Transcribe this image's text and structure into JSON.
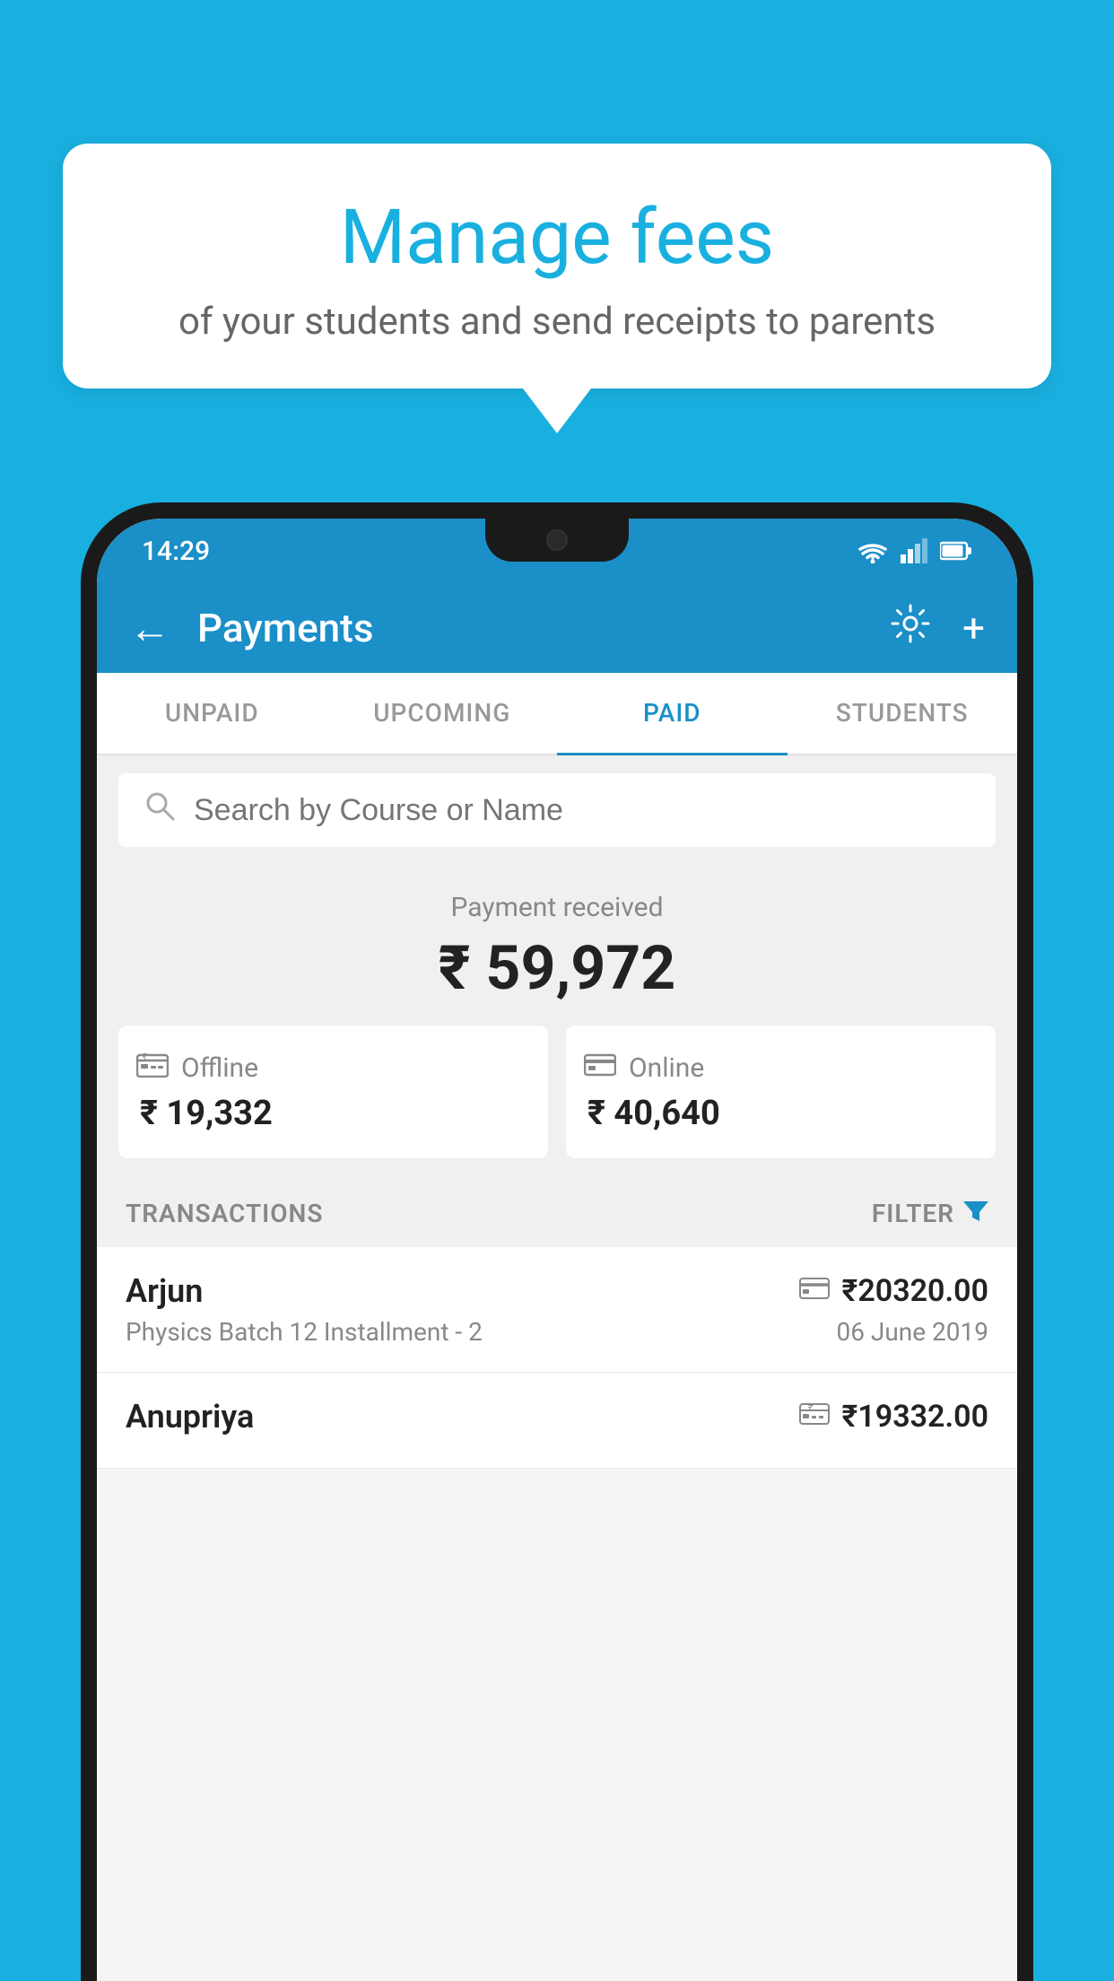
{
  "app": {
    "background_color": "#19b0e0"
  },
  "speech_bubble": {
    "title": "Manage fees",
    "subtitle": "of your students and send receipts to parents"
  },
  "status_bar": {
    "time": "14:29",
    "wifi_icon": "▲",
    "signal_icon": "▲",
    "battery_icon": "▐"
  },
  "app_bar": {
    "title": "Payments",
    "back_icon": "←",
    "settings_icon": "⚙",
    "add_icon": "+"
  },
  "tabs": [
    {
      "label": "UNPAID",
      "active": false
    },
    {
      "label": "UPCOMING",
      "active": false
    },
    {
      "label": "PAID",
      "active": true
    },
    {
      "label": "STUDENTS",
      "active": false
    }
  ],
  "search": {
    "placeholder": "Search by Course or Name"
  },
  "payment_summary": {
    "label": "Payment received",
    "total_amount": "₹ 59,972",
    "offline": {
      "label": "Offline",
      "amount": "₹ 19,332"
    },
    "online": {
      "label": "Online",
      "amount": "₹ 40,640"
    }
  },
  "transactions": {
    "section_label": "TRANSACTIONS",
    "filter_label": "FILTER",
    "rows": [
      {
        "name": "Arjun",
        "amount": "₹20320.00",
        "course": "Physics Batch 12 Installment - 2",
        "date": "06 June 2019",
        "payment_type": "online"
      },
      {
        "name": "Anupriya",
        "amount": "₹19332.00",
        "course": "",
        "date": "",
        "payment_type": "offline"
      }
    ]
  }
}
